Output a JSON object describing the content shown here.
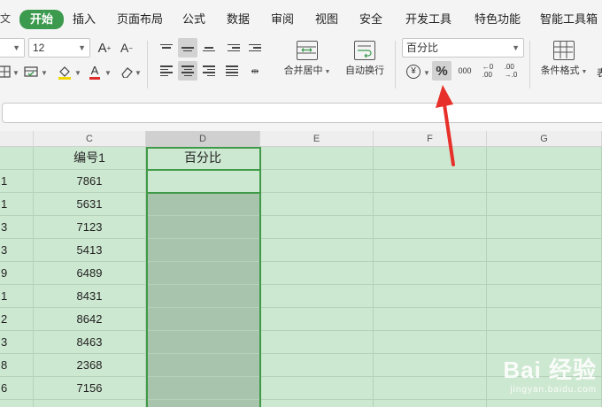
{
  "menu": {
    "left_glyph": "文",
    "items": [
      "开始",
      "插入",
      "页面布局",
      "公式",
      "数据",
      "审阅",
      "视图",
      "安全",
      "开发工具",
      "特色功能",
      "智能工具箱"
    ]
  },
  "ribbon": {
    "font_size": "12",
    "merge_center": "合并居中",
    "wrap_text": "自动换行",
    "number_format": "百分比",
    "currency_glyph": "¥",
    "percent_glyph": "%",
    "thousands_glyph": "000",
    "dec_inc": "←0\n.00",
    "dec_dec": ".00\n→.0",
    "conditional_format": "条件格式",
    "table_style_partial": "表"
  },
  "columns": [
    "C",
    "D",
    "E",
    "F",
    "G"
  ],
  "table": {
    "header_c": "编号1",
    "header_d": "百分比",
    "rows": [
      {
        "rownum": "1",
        "c": "7861"
      },
      {
        "rownum": "1",
        "c": "5631"
      },
      {
        "rownum": "3",
        "c": "7123"
      },
      {
        "rownum": "3",
        "c": "5413"
      },
      {
        "rownum": "9",
        "c": "6489"
      },
      {
        "rownum": "1",
        "c": "8431"
      },
      {
        "rownum": "2",
        "c": "8642"
      },
      {
        "rownum": "3",
        "c": "8463"
      },
      {
        "rownum": "8",
        "c": "2368"
      },
      {
        "rownum": "6",
        "c": "7156"
      }
    ]
  },
  "watermark": {
    "brand": "Bai 经验",
    "url": "jingyan.baidu.com"
  },
  "colors": {
    "accent": "#3b9a4d",
    "grid_bg": "#cde8d1",
    "selected_col": "#a9c4ad",
    "annotation": "#e8302a"
  }
}
